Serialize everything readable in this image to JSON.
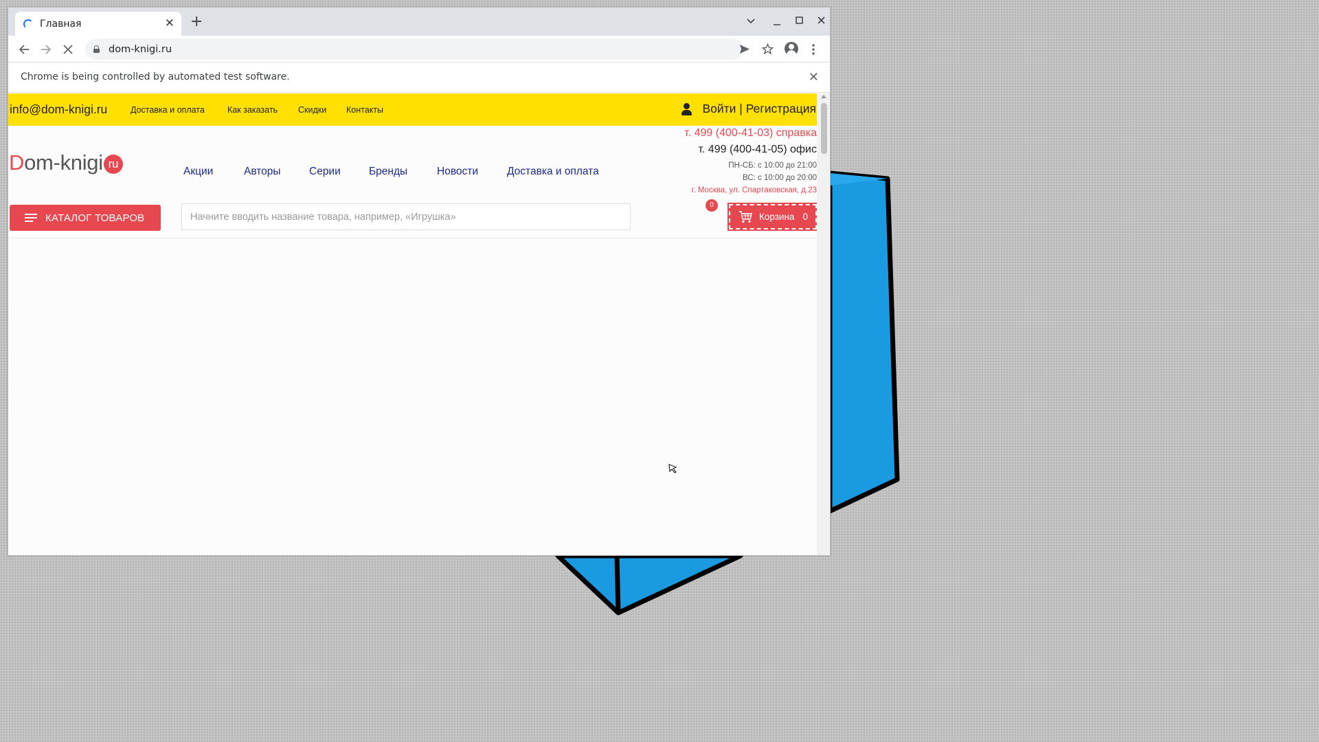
{
  "browser": {
    "tab_title": "Главная",
    "tab_close": "✕",
    "new_tab": "+",
    "url": "dom-knigi.ru",
    "infobar_text": "Chrome is being controlled by automated test software.",
    "infobar_close": "✕",
    "icons": [
      "chevron-down-icon",
      "minimize-icon",
      "maximize-icon",
      "close-icon",
      "back-icon",
      "forward-icon",
      "stop-icon",
      "lock-icon",
      "send-icon",
      "star-icon",
      "profile-icon",
      "menu-icon"
    ]
  },
  "site": {
    "topbar": {
      "email": "info@dom-knigi.ru",
      "links": [
        "Доставка и оплата",
        "Как заказать",
        "Скидки",
        "Контакты"
      ],
      "login": "Войти | Регистрация"
    },
    "logo": {
      "d": "D",
      "rest": "om-knigi",
      "badge": "ru"
    },
    "nav": [
      "Акции",
      "Авторы",
      "Серии",
      "Бренды",
      "Новости",
      "Доставка и оплата"
    ],
    "contacts": {
      "phone_help": "т. 499 (400-41-03) справка",
      "phone_office": "т. 499 (400-41-05) офис",
      "hours_weekdays": "ПН-СБ: с 10:00 до 21:00",
      "hours_sunday": "ВС: с 10:00 до 20:00",
      "address": "г. Москва, ул. Спартаковская, д.23"
    },
    "catalog_button": "КАТАЛОГ ТОВАРОВ",
    "search_placeholder": "Начните вводить название товара, например, «Игрушка»",
    "compare_count": "0",
    "cart": {
      "label": "Корзина",
      "count": "0"
    }
  },
  "colors": {
    "accent_red": "#e7484f",
    "topbar_yellow": "#ffe000",
    "nav_blue": "#1a2a8c",
    "desktop_shape": "#1a9ae0"
  }
}
